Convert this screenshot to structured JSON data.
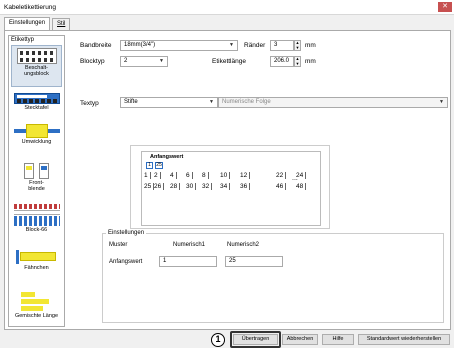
{
  "window": {
    "title": "Kabeletikettierung",
    "close_icon": "close-icon"
  },
  "tabs": [
    {
      "label": "Einstellungen"
    },
    {
      "label": "Stil"
    }
  ],
  "sidebar": {
    "header": "Etikettyp",
    "items": [
      {
        "label": "Beschalt-ungsblock",
        "icon": "terminal-block-icon"
      },
      {
        "label": "Stecktafel",
        "icon": "patch-panel-icon"
      },
      {
        "label": "Umwicklung",
        "icon": "wrap-icon"
      },
      {
        "label": "Front-blende",
        "icon": "faceplate-icon"
      },
      {
        "label": "Block-66",
        "icon": "block-66-icon"
      },
      {
        "label": "Fähnchen",
        "icon": "flag-icon"
      },
      {
        "label": "Gemischte Länge",
        "icon": "mixed-length-icon"
      }
    ]
  },
  "form": {
    "bandbreite_label": "Bandbreite",
    "bandbreite_value": "18mm(3/4\")",
    "raender_label": "Ränder",
    "raender_value": "3",
    "raender_unit": "mm",
    "blocktyp_label": "Blocktyp",
    "blocktyp_value": "2",
    "etikettlaenge_label": "Etikettlänge",
    "etikettlaenge_value": "206.0",
    "etikettlaenge_unit": "mm",
    "textyp_label": "Textyp",
    "textyp_value": "Stifte",
    "folge_value": "Numerische Folge"
  },
  "preview": {
    "heading": "Anfangswert",
    "small_boxes": [
      "1",
      "25"
    ],
    "row1": [
      "1",
      "2",
      "4",
      "6",
      "8",
      "10",
      "12",
      "22",
      "24"
    ],
    "row2": [
      "25",
      "26",
      "28",
      "30",
      "32",
      "34",
      "36",
      "46",
      "48"
    ],
    "dots": "..."
  },
  "settings": {
    "title": "Einstellungen",
    "muster_label": "Muster",
    "col1": "Numerisch1",
    "col2": "Numerisch2",
    "anfangswert_label": "Anfangswert",
    "val1": "1",
    "val2": "25"
  },
  "buttons": {
    "uebertragen": "Übertragen",
    "abbrechen": "Abbrechen",
    "hilfe": "Hilfe",
    "standard": "Standardwert wiederherstellen"
  },
  "callout": "1"
}
